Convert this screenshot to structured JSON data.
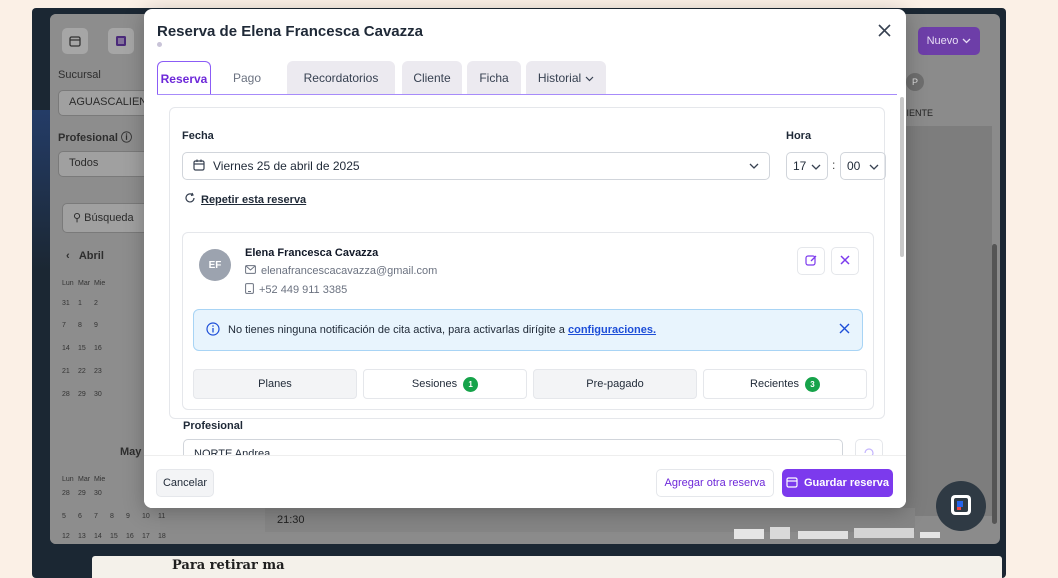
{
  "background": {
    "sidebar": {
      "sucursal_label": "Sucursal",
      "sucursal_value": "AGUASCALIEN",
      "profesional_label": "Profesional",
      "profesional_value": "Todos",
      "search_label": "Búsqueda",
      "calendar_april": {
        "month": "Abril",
        "weekdays": [
          "Lun",
          "Mar",
          "Mie"
        ],
        "rows": [
          [
            "31",
            "1",
            "2"
          ],
          [
            "7",
            "8",
            "9"
          ],
          [
            "14",
            "15",
            "16"
          ],
          [
            "21",
            "22",
            "23"
          ],
          [
            "28",
            "29",
            "30"
          ]
        ]
      },
      "calendar_may": {
        "month": "May",
        "weekdays": [
          "Lun",
          "Mar",
          "Mie"
        ],
        "rows": [
          [
            "28",
            "29",
            "30"
          ],
          [
            "5",
            "6",
            "7",
            "8",
            "9",
            "10",
            "11"
          ],
          [
            "12",
            "13",
            "14",
            "15",
            "16",
            "17",
            "18"
          ]
        ]
      }
    },
    "header": {
      "nuevo_label": "Nuevo",
      "avatar_letter": "P",
      "column_label": "NIENTE"
    },
    "grid": {
      "time_label": "21:30"
    },
    "paper_text": "Para retirar ma"
  },
  "modal": {
    "title": "Reserva de Elena Francesca Cavazza",
    "tabs": [
      {
        "label": "Reserva",
        "active": true
      },
      {
        "label": "Pago"
      },
      {
        "label": "Recordatorios"
      },
      {
        "label": "Cliente"
      },
      {
        "label": "Ficha"
      },
      {
        "label": "Historial"
      }
    ],
    "fecha_label": "Fecha",
    "fecha_value": "Viernes 25 de abril de 2025",
    "hora_label": "Hora",
    "hora_hour": "17",
    "hora_minute": "00",
    "repeat_label": "Repetir esta reserva",
    "client": {
      "initials": "EF",
      "name": "Elena Francesca Cavazza",
      "email": "elenafrancescacavazza@gmail.com",
      "phone": "+52 449 911 3385"
    },
    "notice": {
      "text": "No tienes ninguna notificación de cita activa, para activarlas dirígite a",
      "link": "configuraciones."
    },
    "subtabs": [
      {
        "label": "Planes"
      },
      {
        "label": "Sesiones",
        "badge": "1"
      },
      {
        "label": "Pre-pagado"
      },
      {
        "label": "Recientes",
        "badge": "3"
      }
    ],
    "profesional_label": "Profesional",
    "profesional_value": "NORTE Andrea",
    "footer": {
      "cancel_label": "Cancelar",
      "add_label": "Agregar otra reserva",
      "save_label": "Guardar reserva"
    }
  },
  "colors": {
    "accent": "#7c3aed",
    "badge_green": "#16a34a",
    "notice_bg": "#e8f4fd"
  }
}
